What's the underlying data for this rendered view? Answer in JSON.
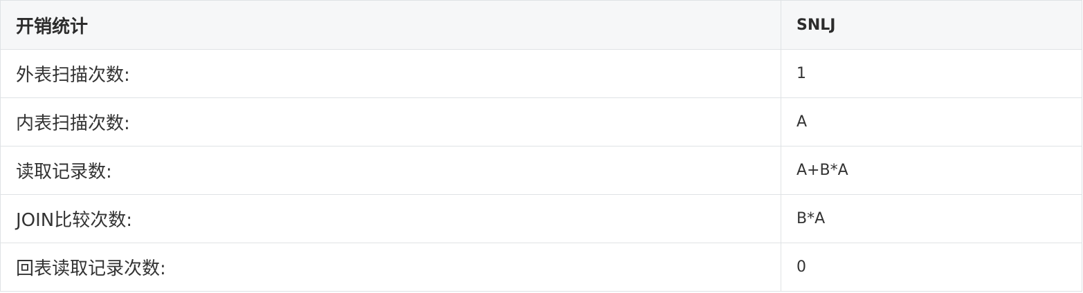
{
  "table": {
    "headers": [
      "开销统计",
      "SNLJ"
    ],
    "rows": [
      {
        "label": "外表扫描次数:",
        "value": "1"
      },
      {
        "label": "内表扫描次数:",
        "value": "A"
      },
      {
        "label": "读取记录数:",
        "value": "A+B*A"
      },
      {
        "label": "JOIN比较次数:",
        "value": "B*A"
      },
      {
        "label": "回表读取记录次数:",
        "value": "0"
      }
    ]
  },
  "colors": {
    "header_background": "#f6f7f8",
    "border": "#dfe2e5",
    "text": "#333333"
  }
}
